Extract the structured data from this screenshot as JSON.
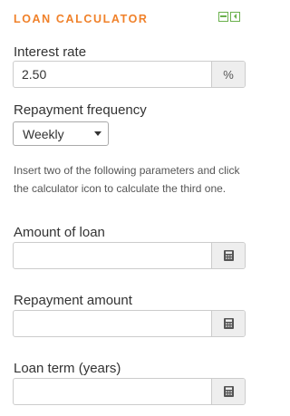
{
  "widget": {
    "title": "LOAN CALCULATOR",
    "header_icons": [
      "minimize-icon",
      "popout-icon"
    ]
  },
  "interest": {
    "label": "Interest rate",
    "value": "2.50",
    "unit": "%"
  },
  "frequency": {
    "label": "Repayment frequency",
    "selected": "Weekly"
  },
  "help_text": "Insert two of the following parameters and click the calculator icon to calculate the third one.",
  "fields": {
    "amount": {
      "label": "Amount of loan",
      "value": ""
    },
    "repayment": {
      "label": "Repayment amount",
      "value": ""
    },
    "term": {
      "label": "Loan term (years)",
      "value": ""
    }
  },
  "colors": {
    "title": "#f0812a",
    "header_icons": "#6ab04c"
  }
}
